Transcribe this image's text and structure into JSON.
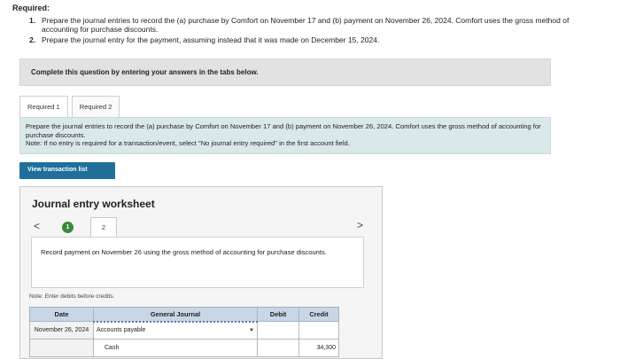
{
  "required": {
    "title": "Required:",
    "items": [
      {
        "num": "1.",
        "text": "Prepare the journal entries to record the (a) purchase by Comfort on November 17 and (b) payment on November 26, 2024. Comfort uses the gross method of accounting for purchase discounts."
      },
      {
        "num": "2.",
        "text": "Prepare the journal entry for the payment, assuming instead that it was made on December 15, 2024."
      }
    ]
  },
  "complete_banner": "Complete this question by entering your answers in the tabs below.",
  "tabs": [
    {
      "label": "Required 1",
      "active": true
    },
    {
      "label": "Required 2",
      "active": false
    }
  ],
  "instructions": {
    "text": "Prepare the journal entries to record the (a) purchase by Comfort on November 17 and (b) payment on November 26, 2024. Comfort uses the gross method of accounting for purchase discounts.",
    "note": "Note: If no entry is required for a transaction/event, select \"No journal entry required\" in the first account field."
  },
  "view_transaction_button": "View transaction list",
  "worksheet": {
    "title": "Journal entry worksheet",
    "nav_prev": "<",
    "nav_next": ">",
    "steps": [
      {
        "label": "1",
        "completed": true
      },
      {
        "label": "2",
        "completed": false
      }
    ],
    "record_text": "Record payment on November 26 using the gross method of accounting for purchase discounts.",
    "note": "Note: Enter debits before credits.",
    "table": {
      "headers": {
        "date": "Date",
        "general_journal": "General Journal",
        "debit": "Debit",
        "credit": "Credit"
      },
      "rows": [
        {
          "date": "November 26, 2024",
          "account": "Accounts payable",
          "debit": "",
          "credit": ""
        },
        {
          "date": "",
          "account": "Cash",
          "debit": "",
          "credit": "34,300"
        }
      ]
    }
  },
  "colors": {
    "button_bg": "#1f6f9a",
    "instr_bg": "#dbe8ea",
    "header_bg": "#c9d6e6",
    "step_complete": "#3a8a3a"
  }
}
